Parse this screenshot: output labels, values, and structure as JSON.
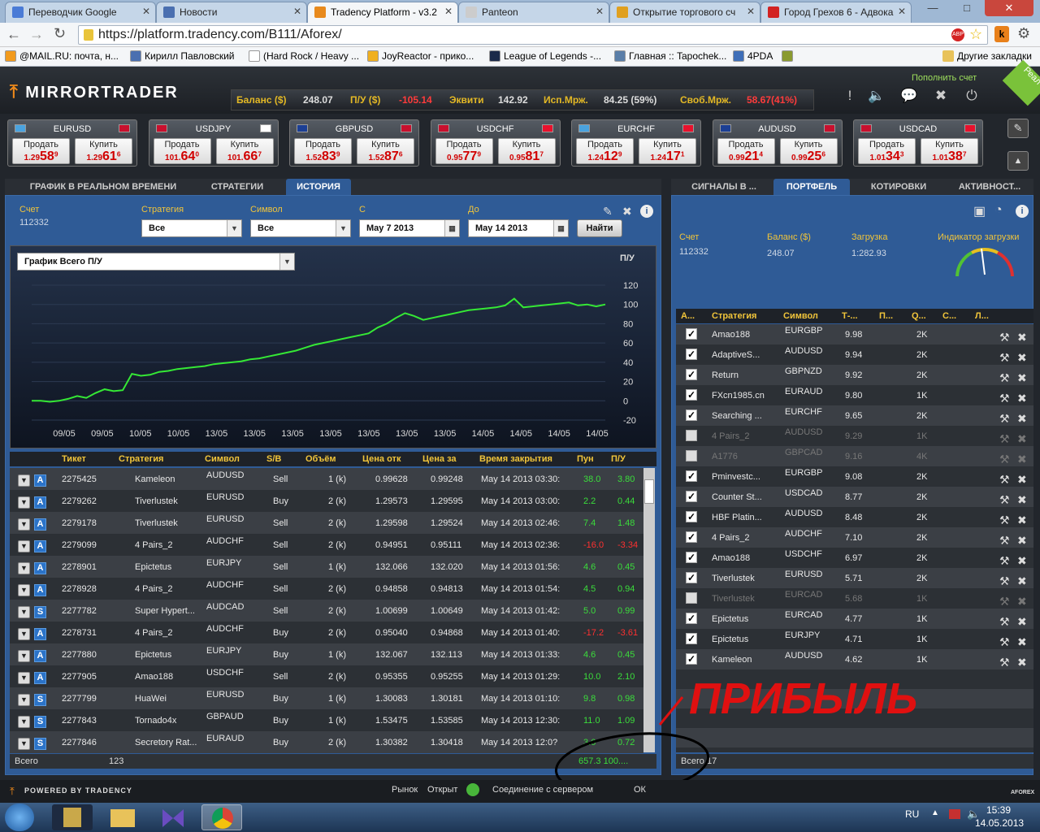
{
  "browser": {
    "tabs": [
      {
        "label": "Переводчик Google",
        "color": "#4a7bd6"
      },
      {
        "label": "Новости",
        "color": "#4a6fb0"
      },
      {
        "label": "Tradency Platform - v3.2",
        "color": "#e88a1d"
      },
      {
        "label": "Panteon",
        "color": "#cccccc"
      },
      {
        "label": "Открытие торгового сч",
        "color": "#e0a020"
      },
      {
        "label": "Город Грехов 6 - Адвока",
        "color": "#d22222"
      }
    ],
    "url": "https://platform.tradency.com/B111/Aforex/",
    "bookmarks": [
      {
        "label": "@MAIL.RU: почта, н...",
        "color": "#f29b1d"
      },
      {
        "label": "Кирилл Павловский",
        "color": "#4a6fb0"
      },
      {
        "label": "(Hard Rock / Heavy ...",
        "color": "#ffffff"
      },
      {
        "label": "JoyReactor - прико...",
        "color": "#f0b020"
      },
      {
        "label": "League of Legends -...",
        "color": "#1b2a4a"
      },
      {
        "label": "Главная :: Tapochek...",
        "color": "#5a7ea8"
      },
      {
        "label": "4PDA",
        "color": "#3f6fb8"
      },
      {
        "label": "",
        "color": "#8a9a30"
      }
    ],
    "other_bookmarks": "Другие закладки"
  },
  "header": {
    "logo": "MIRRORTRADER",
    "balance_label": "Баланс ($)",
    "balance": "248.07",
    "pl_label": "П/У ($)",
    "pl": "-105.14",
    "equity_label": "Эквити",
    "equity": "142.92",
    "used_margin_label": "Исп.Мрж.",
    "used_margin": "84.25 (59%)",
    "free_margin_label": "Своб.Мрж.",
    "free_margin": "58.67(41%)",
    "topup": "Пополнить счет",
    "real": "Реал"
  },
  "quotes": [
    {
      "symbol": "EURUSD",
      "sell_label": "Продать",
      "buy_label": "Купить",
      "sell_pre": "1.29",
      "sell_big": "58",
      "sell_sup": "9",
      "buy_pre": "1.29",
      "buy_big": "61",
      "buy_sup": "6",
      "f1": "#4aa3df",
      "f2": "#c8102e"
    },
    {
      "symbol": "USDJPY",
      "sell_label": "Продать",
      "buy_label": "Купить",
      "sell_pre": "101.",
      "sell_big": "64",
      "sell_sup": "0",
      "buy_pre": "101.",
      "buy_big": "66",
      "buy_sup": "7",
      "f1": "#c8102e",
      "f2": "#ffffff"
    },
    {
      "symbol": "GBPUSD",
      "sell_label": "Продать",
      "buy_label": "Купить",
      "sell_pre": "1.52",
      "sell_big": "83",
      "sell_sup": "9",
      "buy_pre": "1.52",
      "buy_big": "87",
      "buy_sup": "6",
      "f1": "#1c3f94",
      "f2": "#c8102e"
    },
    {
      "symbol": "USDCHF",
      "sell_label": "Продать",
      "buy_label": "Купить",
      "sell_pre": "0.95",
      "sell_big": "77",
      "sell_sup": "9",
      "buy_pre": "0.95",
      "buy_big": "81",
      "buy_sup": "7",
      "f1": "#c8102e",
      "f2": "#e8112d"
    },
    {
      "symbol": "EURCHF",
      "sell_label": "Продать",
      "buy_label": "Купить",
      "sell_pre": "1.24",
      "sell_big": "12",
      "sell_sup": "9",
      "buy_pre": "1.24",
      "buy_big": "17",
      "buy_sup": "1",
      "f1": "#4aa3df",
      "f2": "#e8112d"
    },
    {
      "symbol": "AUDUSD",
      "sell_label": "Продать",
      "buy_label": "Купить",
      "sell_pre": "0.99",
      "sell_big": "21",
      "sell_sup": "4",
      "buy_pre": "0.99",
      "buy_big": "25",
      "buy_sup": "6",
      "f1": "#1c3f94",
      "f2": "#c8102e"
    },
    {
      "symbol": "USDCAD",
      "sell_label": "Продать",
      "buy_label": "Купить",
      "sell_pre": "1.01",
      "sell_big": "34",
      "sell_sup": "3",
      "buy_pre": "1.01",
      "buy_big": "38",
      "buy_sup": "7",
      "f1": "#c8102e",
      "f2": "#e8112d"
    }
  ],
  "left_tabs": [
    "ГРАФИК В РЕАЛЬНОМ ВРЕМЕНИ",
    "СТРАТЕГИИ",
    "ИСТОРИЯ"
  ],
  "right_tabs": [
    "СИГНАЛЫ В ...",
    "ПОРТФЕЛЬ",
    "КОТИРОВКИ",
    "АКТИВНОСТ..."
  ],
  "filters": {
    "account_label": "Счет",
    "account": "112332",
    "strategy_label": "Стратегия",
    "strategy": "Все",
    "symbol_label": "Символ",
    "symbol": "Все",
    "from_label": "С",
    "from": "May 7 2013",
    "to_label": "До",
    "to": "May 14 2013",
    "find": "Найти",
    "chart_select": "График Всего П/У"
  },
  "chart_data": {
    "type": "line",
    "ylabel": "П/У",
    "ylim": [
      -20,
      120
    ],
    "yticks": [
      120,
      100,
      80,
      60,
      40,
      20,
      0,
      -20
    ],
    "xticks": [
      "09/05",
      "09/05",
      "10/05",
      "10/05",
      "13/05",
      "13/05",
      "13/05",
      "13/05",
      "13/05",
      "13/05",
      "13/05",
      "14/05",
      "14/05",
      "14/05",
      "14/05"
    ],
    "values": [
      0,
      0,
      -1,
      0,
      2,
      5,
      3,
      8,
      12,
      10,
      11,
      28,
      26,
      27,
      30,
      31,
      33,
      34,
      35,
      36,
      38,
      39,
      40,
      41,
      43,
      44,
      46,
      48,
      50,
      52,
      55,
      58,
      60,
      62,
      64,
      66,
      68,
      70,
      76,
      80,
      86,
      91,
      88,
      84,
      86,
      88,
      90,
      92,
      94,
      95,
      96,
      97,
      99,
      106,
      97,
      98,
      99,
      100,
      101,
      102,
      99,
      100,
      98,
      100
    ]
  },
  "history": {
    "headers": [
      "Тикет",
      "Стратегия",
      "Символ",
      "S/B",
      "Объём",
      "Цена отк",
      "Цена за",
      "Время закрытия",
      "Пун",
      "П/У"
    ],
    "rows": [
      {
        "btn": "A",
        "ticket": "2275425",
        "strategy": "Kameleon",
        "symbol": "AUDUSD",
        "sb": "Sell",
        "vol": "1 (k)",
        "open": "0.99628",
        "close": "0.99248",
        "time": "May 14 2013 03:30:",
        "pts": "38.0",
        "pl": "3.80",
        "neg": false
      },
      {
        "btn": "A",
        "ticket": "2279262",
        "strategy": "Tiverlustek",
        "symbol": "EURUSD",
        "sb": "Buy",
        "vol": "2 (k)",
        "open": "1.29573",
        "close": "1.29595",
        "time": "May 14 2013 03:00:",
        "pts": "2.2",
        "pl": "0.44",
        "neg": false
      },
      {
        "btn": "A",
        "ticket": "2279178",
        "strategy": "Tiverlustek",
        "symbol": "EURUSD",
        "sb": "Sell",
        "vol": "2 (k)",
        "open": "1.29598",
        "close": "1.29524",
        "time": "May 14 2013 02:46:",
        "pts": "7.4",
        "pl": "1.48",
        "neg": false
      },
      {
        "btn": "A",
        "ticket": "2279099",
        "strategy": "4 Pairs_2",
        "symbol": "AUDCHF",
        "sb": "Sell",
        "vol": "2 (k)",
        "open": "0.94951",
        "close": "0.95111",
        "time": "May 14 2013 02:36:",
        "pts": "-16.0",
        "pl": "-3.34",
        "neg": true
      },
      {
        "btn": "A",
        "ticket": "2278901",
        "strategy": "Epictetus",
        "symbol": "EURJPY",
        "sb": "Sell",
        "vol": "1 (k)",
        "open": "132.066",
        "close": "132.020",
        "time": "May 14 2013 01:56:",
        "pts": "4.6",
        "pl": "0.45",
        "neg": false
      },
      {
        "btn": "A",
        "ticket": "2278928",
        "strategy": "4 Pairs_2",
        "symbol": "AUDCHF",
        "sb": "Sell",
        "vol": "2 (k)",
        "open": "0.94858",
        "close": "0.94813",
        "time": "May 14 2013 01:54:",
        "pts": "4.5",
        "pl": "0.94",
        "neg": false
      },
      {
        "btn": "S",
        "ticket": "2277782",
        "strategy": "Super Hypert...",
        "symbol": "AUDCAD",
        "sb": "Sell",
        "vol": "2 (k)",
        "open": "1.00699",
        "close": "1.00649",
        "time": "May 14 2013 01:42:",
        "pts": "5.0",
        "pl": "0.99",
        "neg": false
      },
      {
        "btn": "A",
        "ticket": "2278731",
        "strategy": "4 Pairs_2",
        "symbol": "AUDCHF",
        "sb": "Buy",
        "vol": "2 (k)",
        "open": "0.95040",
        "close": "0.94868",
        "time": "May 14 2013 01:40:",
        "pts": "-17.2",
        "pl": "-3.61",
        "neg": true
      },
      {
        "btn": "A",
        "ticket": "2277880",
        "strategy": "Epictetus",
        "symbol": "EURJPY",
        "sb": "Buy",
        "vol": "1 (k)",
        "open": "132.067",
        "close": "132.113",
        "time": "May 14 2013 01:33:",
        "pts": "4.6",
        "pl": "0.45",
        "neg": false
      },
      {
        "btn": "A",
        "ticket": "2277905",
        "strategy": "Amao188",
        "symbol": "USDCHF",
        "sb": "Sell",
        "vol": "2 (k)",
        "open": "0.95355",
        "close": "0.95255",
        "time": "May 14 2013 01:29:",
        "pts": "10.0",
        "pl": "2.10",
        "neg": false
      },
      {
        "btn": "S",
        "ticket": "2277799",
        "strategy": "HuaWei",
        "symbol": "EURUSD",
        "sb": "Buy",
        "vol": "1 (k)",
        "open": "1.30083",
        "close": "1.30181",
        "time": "May 14 2013 01:10:",
        "pts": "9.8",
        "pl": "0.98",
        "neg": false
      },
      {
        "btn": "S",
        "ticket": "2277843",
        "strategy": "Tornado4x",
        "symbol": "GBPAUD",
        "sb": "Buy",
        "vol": "1 (k)",
        "open": "1.53475",
        "close": "1.53585",
        "time": "May 14 2013 12:30:",
        "pts": "11.0",
        "pl": "1.09",
        "neg": false
      },
      {
        "btn": "S",
        "ticket": "2277846",
        "strategy": "Secretory Rat...",
        "symbol": "EURAUD",
        "sb": "Buy",
        "vol": "2 (k)",
        "open": "1.30382",
        "close": "1.30418",
        "time": "May 14 2013 12:0?",
        "pts": "3.6",
        "pl": "0.72",
        "neg": false
      }
    ],
    "total_label": "Всего",
    "total_count": "123",
    "total_value": "657.3 100...."
  },
  "portfolio": {
    "account_label": "Счет",
    "account": "112332",
    "balance_label": "Баланс ($)",
    "balance": "248.07",
    "load_label": "Загрузка",
    "load": "1:282.93",
    "indicator_label": "Индикатор загрузки",
    "headers": [
      "А...",
      "Стратегия",
      "Символ",
      "Т-...",
      "П...",
      "Q...",
      "С...",
      "Л..."
    ],
    "rows": [
      {
        "on": true,
        "strategy": "Amao188",
        "symbol": "EURGBP",
        "t": "9.98",
        "q": "2K"
      },
      {
        "on": true,
        "strategy": "AdaptiveS...",
        "symbol": "AUDUSD",
        "t": "9.94",
        "q": "2K"
      },
      {
        "on": true,
        "strategy": "Return",
        "symbol": "GBPNZD",
        "t": "9.92",
        "q": "2K"
      },
      {
        "on": true,
        "strategy": "FXcn1985.cn",
        "symbol": "EURAUD",
        "t": "9.80",
        "q": "1K"
      },
      {
        "on": true,
        "strategy": "Searching ...",
        "symbol": "EURCHF",
        "t": "9.65",
        "q": "2K"
      },
      {
        "on": false,
        "strategy": "4 Pairs_2",
        "symbol": "AUDUSD",
        "t": "9.29",
        "q": "1K"
      },
      {
        "on": false,
        "strategy": "A1776",
        "symbol": "GBPCAD",
        "t": "9.16",
        "q": "4K"
      },
      {
        "on": true,
        "strategy": "Pminvestc...",
        "symbol": "EURGBP",
        "t": "9.08",
        "q": "2K"
      },
      {
        "on": true,
        "strategy": "Counter St...",
        "symbol": "USDCAD",
        "t": "8.77",
        "q": "2K"
      },
      {
        "on": true,
        "strategy": "HBF Platin...",
        "symbol": "AUDUSD",
        "t": "8.48",
        "q": "2K"
      },
      {
        "on": true,
        "strategy": "4 Pairs_2",
        "symbol": "AUDCHF",
        "t": "7.10",
        "q": "2K"
      },
      {
        "on": true,
        "strategy": "Amao188",
        "symbol": "USDCHF",
        "t": "6.97",
        "q": "2K"
      },
      {
        "on": true,
        "strategy": "Tiverlustek",
        "symbol": "EURUSD",
        "t": "5.71",
        "q": "2K"
      },
      {
        "on": false,
        "strategy": "Tiverlustek",
        "symbol": "EURCAD",
        "t": "5.68",
        "q": "1K"
      },
      {
        "on": true,
        "strategy": "Epictetus",
        "symbol": "EURCAD",
        "t": "4.77",
        "q": "1K"
      },
      {
        "on": true,
        "strategy": "Epictetus",
        "symbol": "EURJPY",
        "t": "4.71",
        "q": "1K"
      },
      {
        "on": true,
        "strategy": "Kameleon",
        "symbol": "AUDUSD",
        "t": "4.62",
        "q": "1K"
      }
    ],
    "total_label": "Всего",
    "total_count": "17"
  },
  "annotation_text": "ПРИБЫЛЬ",
  "statusbar": {
    "powered": "POWERED BY TRADENCY",
    "market_label": "Рынок",
    "market": "Открыт",
    "conn_label": "Соединение с сервером",
    "conn": "ОК",
    "brand": "AFOREX"
  },
  "taskbar": {
    "lang": "RU",
    "time": "15:39",
    "date": "14.05.2013"
  }
}
